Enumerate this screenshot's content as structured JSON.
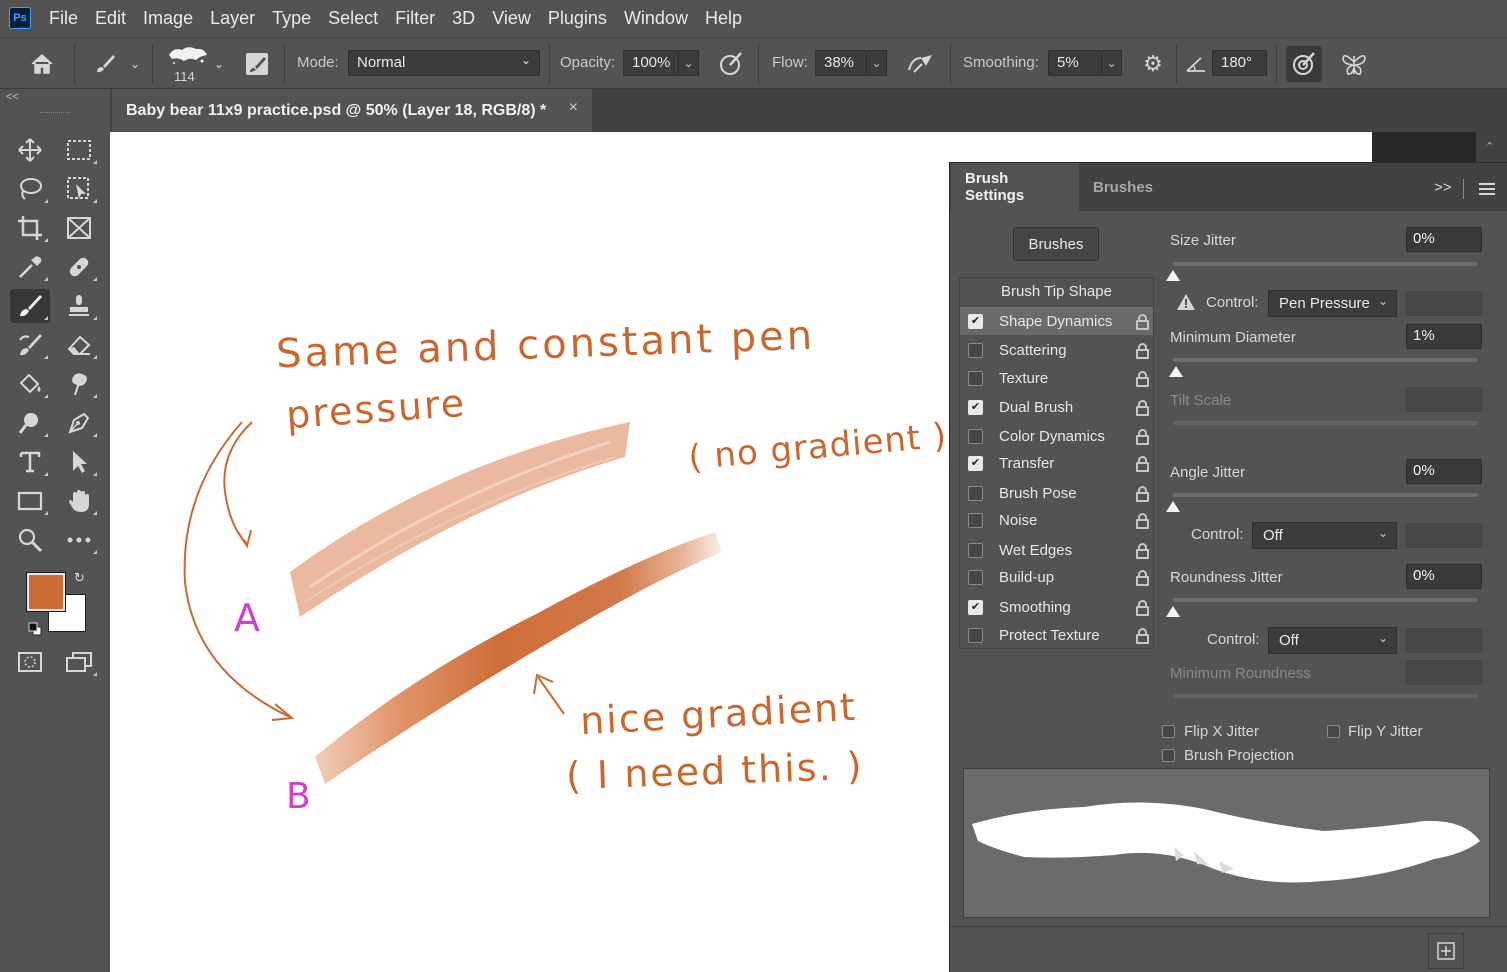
{
  "app": {
    "logo": "Ps"
  },
  "menu": [
    "File",
    "Edit",
    "Image",
    "Layer",
    "Type",
    "Select",
    "Filter",
    "3D",
    "View",
    "Plugins",
    "Window",
    "Help"
  ],
  "options": {
    "brush_size": "114",
    "mode_label": "Mode:",
    "mode_value": "Normal",
    "opacity_label": "Opacity:",
    "opacity_value": "100%",
    "flow_label": "Flow:",
    "flow_value": "38%",
    "smoothing_label": "Smoothing:",
    "smoothing_value": "5%",
    "angle_value": "180°"
  },
  "toolbar": {
    "collapse": "<<"
  },
  "document": {
    "tab_title": "Baby bear 11x9 practice.psd @ 50% (Layer 18, RGB/8) *",
    "close": "×"
  },
  "colors": {
    "foreground": "#cc6d35",
    "background": "#ffffff"
  },
  "canvas_notes": {
    "line1": "Same and constant pen",
    "line2": "pressure",
    "no_gradient": "( no gradient )",
    "label_a": "A",
    "label_b": "B",
    "nice": "nice gradient",
    "need": "( I need this. )"
  },
  "panel": {
    "tabs": [
      "Brush Settings",
      "Brushes"
    ],
    "expand": ">>",
    "brushes_button": "Brushes",
    "tip_shape": "Brush Tip Shape",
    "items": [
      {
        "label": "Shape Dynamics",
        "checked": true,
        "selected": true
      },
      {
        "label": "Scattering",
        "checked": false
      },
      {
        "label": "Texture",
        "checked": false
      },
      {
        "label": "Dual Brush",
        "checked": true
      },
      {
        "label": "Color Dynamics",
        "checked": false
      },
      {
        "label": "Transfer",
        "checked": true
      },
      {
        "label": "Brush Pose",
        "checked": false
      },
      {
        "label": "Noise",
        "checked": false
      },
      {
        "label": "Wet Edges",
        "checked": false
      },
      {
        "label": "Build-up",
        "checked": false
      },
      {
        "label": "Smoothing",
        "checked": true
      },
      {
        "label": "Protect Texture",
        "checked": false
      }
    ],
    "size_jitter_label": "Size Jitter",
    "size_jitter_value": "0%",
    "control_label": "Control:",
    "control1_value": "Pen Pressure",
    "min_diameter_label": "Minimum Diameter",
    "min_diameter_value": "1%",
    "tilt_scale_label": "Tilt Scale",
    "angle_jitter_label": "Angle Jitter",
    "angle_jitter_value": "0%",
    "control2_value": "Off",
    "roundness_jitter_label": "Roundness Jitter",
    "roundness_jitter_value": "0%",
    "control3_value": "Off",
    "min_roundness_label": "Minimum Roundness",
    "flip_x": "Flip X Jitter",
    "flip_y": "Flip Y Jitter",
    "brush_projection": "Brush Projection"
  }
}
